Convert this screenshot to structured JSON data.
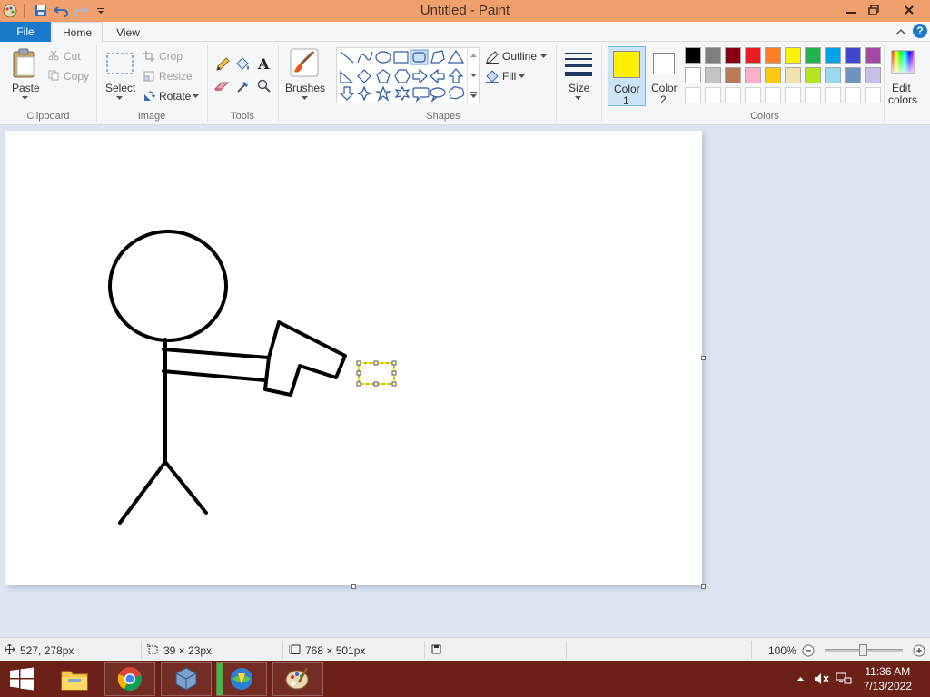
{
  "window": {
    "title": "Untitled - Paint"
  },
  "menu": {
    "file": "File",
    "home": "Home",
    "view": "View",
    "help": "?"
  },
  "ribbon": {
    "clipboard": {
      "label": "Clipboard",
      "paste": "Paste",
      "cut": "Cut",
      "copy": "Copy"
    },
    "image": {
      "label": "Image",
      "select": "Select",
      "crop": "Crop",
      "resize": "Resize",
      "rotate": "Rotate"
    },
    "tools": {
      "label": "Tools"
    },
    "brushes": {
      "label": "Brushes"
    },
    "shapes": {
      "label": "Shapes",
      "outline": "Outline",
      "fill": "Fill"
    },
    "size": {
      "label": "Size"
    },
    "color1": {
      "label": "Color",
      "num": "1",
      "value": "#ffef00"
    },
    "color2": {
      "label": "Color",
      "num": "2",
      "value": "#ffffff"
    },
    "colors": {
      "label": "Colors",
      "edit": "Edit",
      "edit2": "colors"
    },
    "palette_row1": [
      "#000000",
      "#7f7f7f",
      "#880015",
      "#ed1c24",
      "#ff7f27",
      "#fff200",
      "#22b14c",
      "#00a2e8",
      "#3f48cc",
      "#a349a4"
    ],
    "palette_row2": [
      "#ffffff",
      "#c3c3c3",
      "#b97a57",
      "#ffaec9",
      "#ffc90e",
      "#efe4b0",
      "#b5e61d",
      "#99d9ea",
      "#7092be",
      "#c8bfe7"
    ],
    "palette_row3": [
      "#ffffff",
      "#ffffff",
      "#ffffff",
      "#ffffff",
      "#ffffff",
      "#ffffff",
      "#ffffff",
      "#ffffff",
      "#ffffff",
      "#ffffff"
    ]
  },
  "status": {
    "cursor_pos": "527, 278px",
    "selection_size": "39 × 23px",
    "canvas_size": "768 × 501px",
    "zoom": "100%",
    "zoom_fraction": 0.5
  },
  "taskbar": {
    "time": "11:36 AM",
    "date": "7/13/2022"
  },
  "icons": {
    "save": "save-icon",
    "undo": "undo-icon",
    "redo": "redo-icon",
    "pencil": "pencil-icon",
    "fill": "fill-bucket-icon",
    "text": "text-icon",
    "eraser": "eraser-icon",
    "picker": "color-picker-icon",
    "magnifier": "magnifier-icon"
  }
}
